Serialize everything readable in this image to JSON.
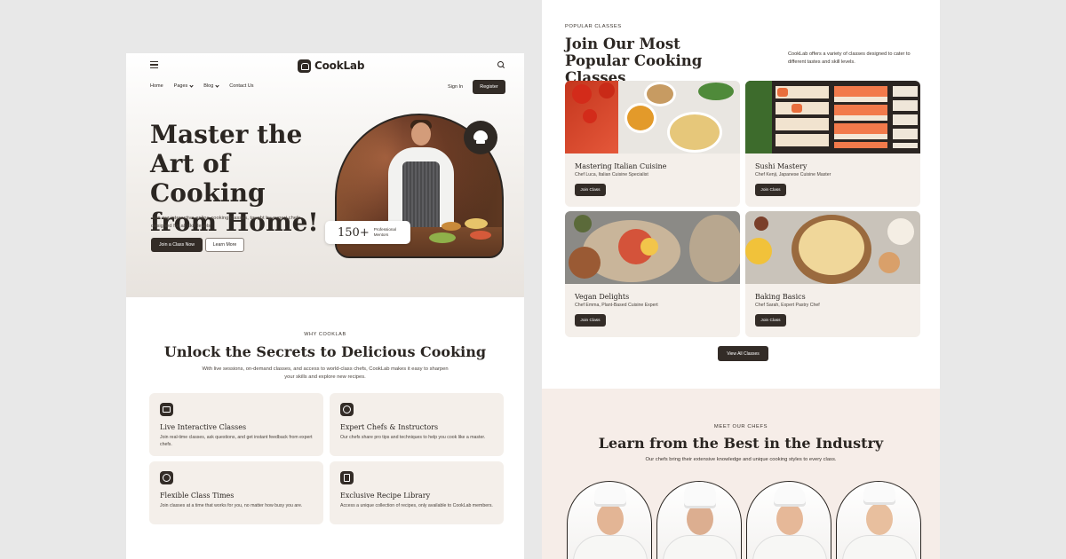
{
  "left_page": {
    "brand": {
      "logo_text": "CookLab",
      "logo_icon": "chef-hat-icon"
    },
    "nav": {
      "items": [
        {
          "label": "Home",
          "has_dropdown": false
        },
        {
          "label": "Pages",
          "has_dropdown": true
        },
        {
          "label": "Blog",
          "has_dropdown": true
        },
        {
          "label": "Contact Us",
          "has_dropdown": false
        }
      ],
      "sign_in": "Sign In",
      "register": "Register"
    },
    "hero": {
      "title": "Master the Art of Cooking from Home!",
      "subtitle": "Join our interactive online cooking classes, taught by expert chefs, designed for all skill levels",
      "primary_button": "Join a Class Now",
      "secondary_button": "Learn More",
      "stat_number": "150+",
      "stat_label": "Professional Mentors"
    },
    "why": {
      "kicker": "WHY COOKLAB",
      "title": "Unlock the Secrets to Delicious Cooking",
      "subtitle": "With live sessions, on-demand classes, and access to world-class chefs, CookLab makes it easy to sharpen your skills and explore new recipes.",
      "features": [
        {
          "icon": "video-play-icon",
          "title": "Live Interactive Classes",
          "desc": "Join real-time classes, ask questions, and get instant feedback from expert chefs."
        },
        {
          "icon": "chef-badge-icon",
          "title": "Expert Chefs & Instructors",
          "desc": "Our chefs share pro tips and techniques to help you cook like a master."
        },
        {
          "icon": "clock-icon",
          "title": "Flexible Class Times",
          "desc": "Join classes at a time that works for you, no matter how busy you are."
        },
        {
          "icon": "recipe-book-icon",
          "title": "Exclusive Recipe Library",
          "desc": "Access a unique collection of recipes, only available to CookLab members."
        }
      ]
    }
  },
  "right_page": {
    "popular": {
      "kicker": "POPULAR CLASSES",
      "title": "Join Our Most Popular Cooking Classes",
      "side_text": "CookLab offers a variety of classes designed to cater to different tastes and skill levels.",
      "classes": [
        {
          "name": "Mastering Italian Cuisine",
          "chef": "Chef Luca, Italian Cuisine Specialist",
          "button": "Join Class"
        },
        {
          "name": "Sushi Mastery",
          "chef": "Chef Kenji, Japanese Cuisine Master",
          "button": "Join Class"
        },
        {
          "name": "Vegan Delights",
          "chef": "Chef Emma, Plant-Based Cuisine Expert",
          "button": "Join Class"
        },
        {
          "name": "Baking Basics",
          "chef": "Chef Sarah, Expert Pastry Chef",
          "button": "Join Class"
        }
      ],
      "view_all": "View All Classes"
    },
    "chefs": {
      "kicker": "MEET OUR CHEFS",
      "title": "Learn from the Best in the Industry",
      "subtitle": "Our chefs bring their extensive knowledge and unique cooking styles to every class."
    }
  },
  "colors": {
    "primary_dark": "#332c27",
    "card_beige": "#f4efea",
    "chefs_bg": "#f6ede8",
    "page_bg": "#e8e8e8"
  }
}
